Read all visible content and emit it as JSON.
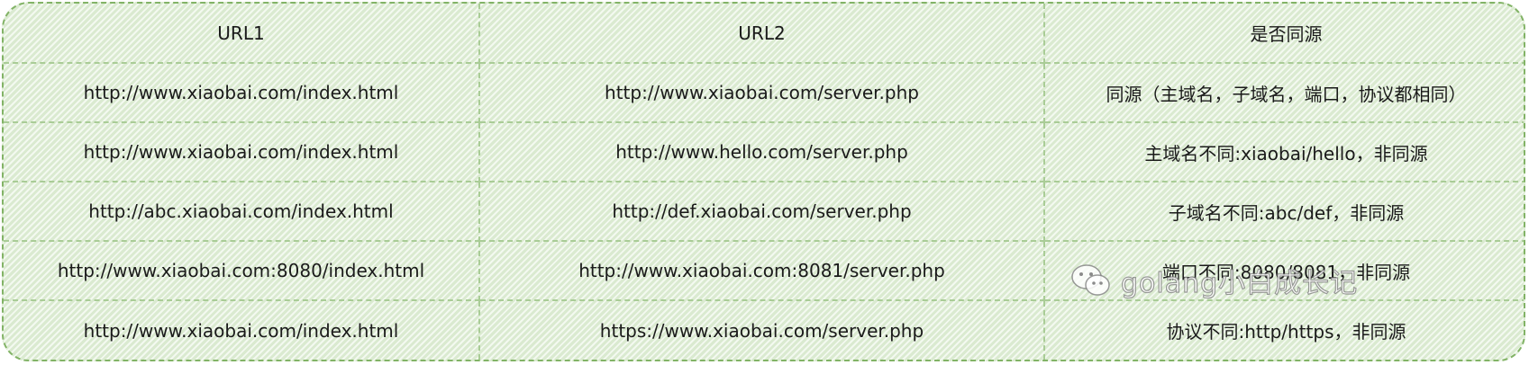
{
  "table": {
    "headers": [
      "URL1",
      "URL2",
      "是否同源"
    ],
    "rows": [
      [
        "http://www.xiaobai.com/index.html",
        "http://www.xiaobai.com/server.php",
        "同源（主域名，子域名，端口，协议都相同）"
      ],
      [
        "http://www.xiaobai.com/index.html",
        "http://www.hello.com/server.php",
        "主域名不同:xiaobai/hello，非同源"
      ],
      [
        "http://abc.xiaobai.com/index.html",
        "http://def.xiaobai.com/server.php",
        "子域名不同:abc/def，非同源"
      ],
      [
        "http://www.xiaobai.com:8080/index.html",
        "http://www.xiaobai.com:8081/server.php",
        "端口不同:8080/8081，非同源"
      ],
      [
        "http://www.xiaobai.com/index.html",
        "https://www.xiaobai.com/server.php",
        "协议不同:http/https，非同源"
      ]
    ]
  },
  "watermark": {
    "text": "golang小白成长记",
    "icon": "wechat-icon"
  },
  "colors": {
    "cell_fill": "#e4f1dd",
    "border": "#82b366"
  }
}
